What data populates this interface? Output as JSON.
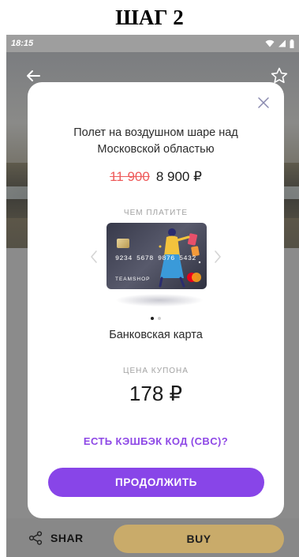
{
  "step_label": "ШАГ 2",
  "status_bar": {
    "time": "18:15",
    "icons": [
      "wifi-icon",
      "signal-icon",
      "battery-icon"
    ]
  },
  "header_icons": [
    "back-arrow-icon",
    "star-icon"
  ],
  "modal": {
    "close_icon": "close-icon",
    "title": "Полет на воздушном шаре над Московской областью",
    "old_price": "11 900",
    "new_price": "8 900 ₽",
    "pay_with_caption": "ЧЕМ ПЛАТИТЕ",
    "card": {
      "number": "9234 5678 9876 5432",
      "brand": "TEAMSHOP",
      "network_icon": "mastercard-icon"
    },
    "carousel": {
      "slide_count": 2,
      "active_index": 0,
      "prev_icon": "chevron-left-icon",
      "next_icon": "chevron-right-icon"
    },
    "payment_method": "Банковская карта",
    "coupon_caption": "ЦЕНА КУПОНА",
    "coupon_price": "178 ₽",
    "cashback_link": "ЕСТЬ КЭШБЭК КОД (CBC)?",
    "continue_label": "ПРОДОЛЖИТЬ"
  },
  "bottom_bar": {
    "share_label": "SHAR",
    "buy_label": "BUY"
  },
  "colors": {
    "accent_purple": "#8845e8",
    "link_purple": "#8e48e6",
    "old_price_red": "#ee5a5a",
    "buy_gold": "#c9ab6a"
  }
}
